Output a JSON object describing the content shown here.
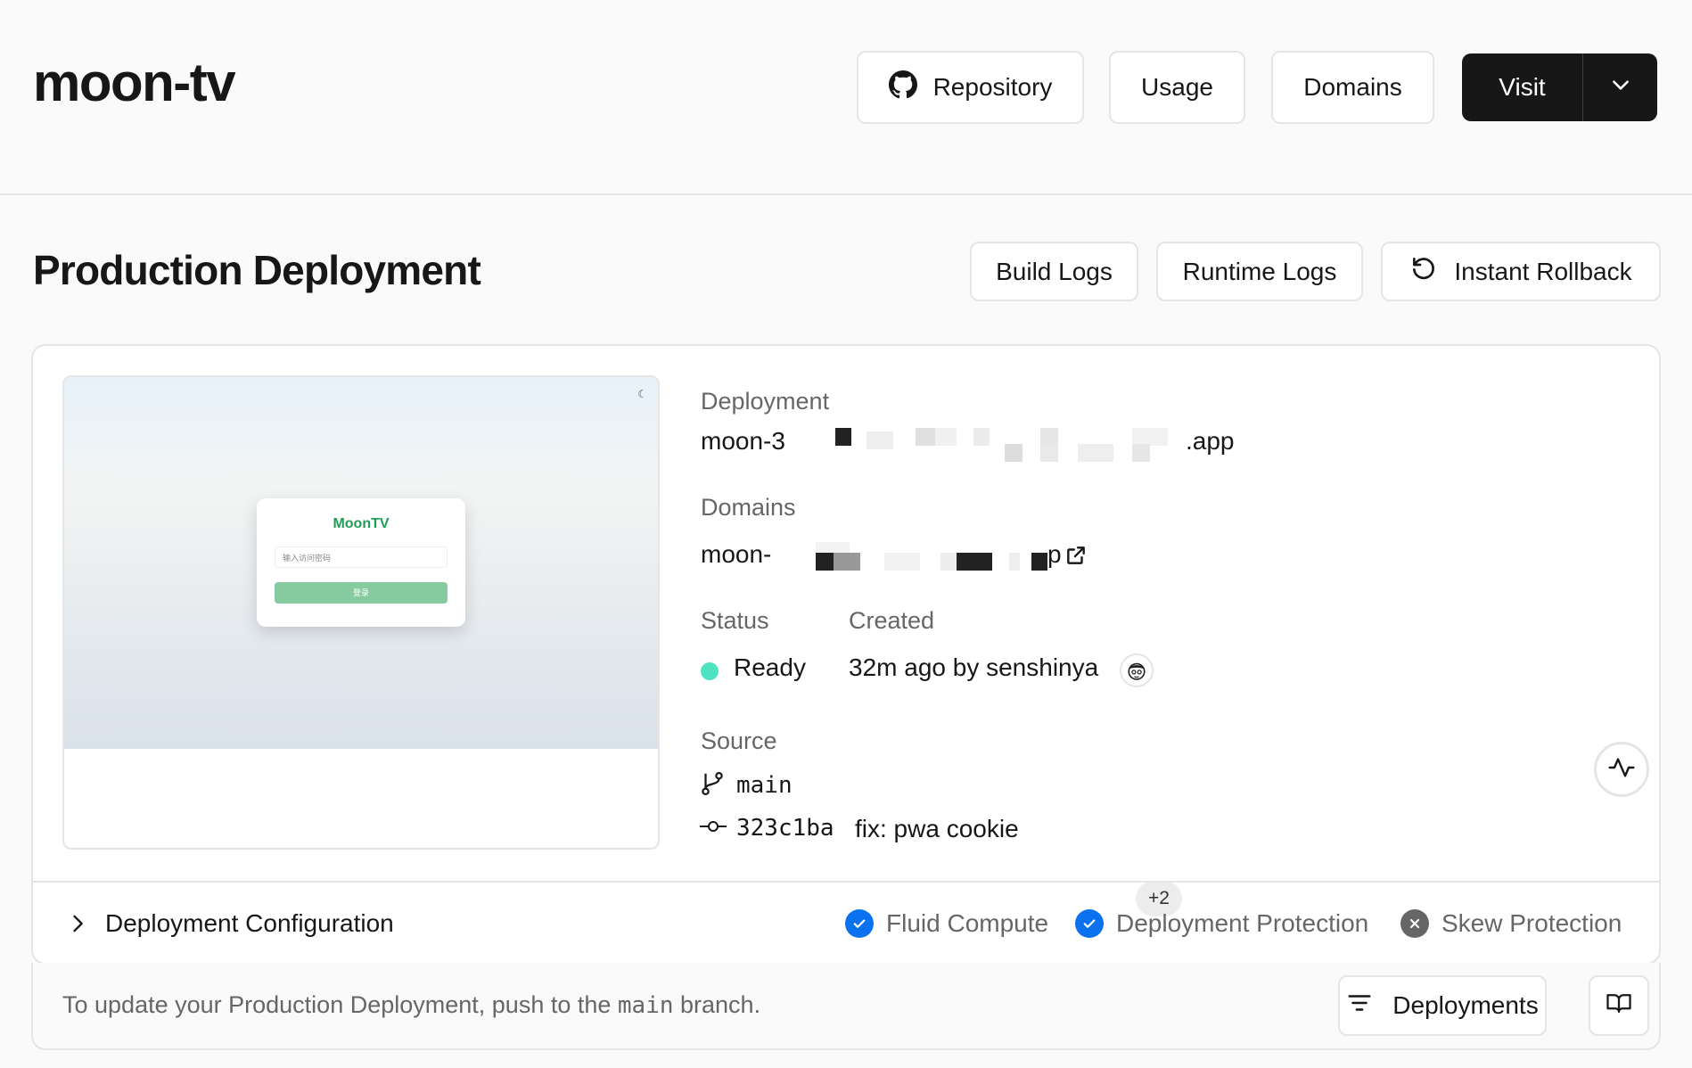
{
  "header": {
    "project_name": "moon-tv",
    "repository_label": "Repository",
    "usage_label": "Usage",
    "domains_label": "Domains",
    "visit_label": "Visit"
  },
  "production": {
    "title": "Production Deployment",
    "build_logs_label": "Build Logs",
    "runtime_logs_label": "Runtime Logs",
    "instant_rollback_label": "Instant Rollback"
  },
  "preview": {
    "app_title": "MoonTV",
    "input_placeholder": "输入访问密码",
    "button_label": "登录"
  },
  "deployment": {
    "label": "Deployment",
    "url_prefix": "moon-3",
    "url_suffix": ".app",
    "domains_label": "Domains",
    "domain_prefix": "moon-",
    "domain_suffix": "p",
    "domains_more": "+2",
    "status_label": "Status",
    "status_value": "Ready",
    "created_label": "Created",
    "created_value": "32m ago by senshinya",
    "source_label": "Source",
    "branch": "main",
    "commit_hash": "323c1ba",
    "commit_message": "fix: pwa cookie"
  },
  "config": {
    "label": "Deployment Configuration",
    "features": [
      {
        "name": "Fluid Compute",
        "enabled": true
      },
      {
        "name": "Deployment Protection",
        "enabled": true
      },
      {
        "name": "Skew Protection",
        "enabled": false
      }
    ]
  },
  "footer": {
    "text_before": "To update your Production Deployment, push to the ",
    "branch": "main",
    "text_after": " branch.",
    "deployments_label": "Deployments"
  },
  "colors": {
    "accent_blue": "#0a72ef",
    "ready_green": "#50e3c2",
    "primary_black": "#171717"
  }
}
